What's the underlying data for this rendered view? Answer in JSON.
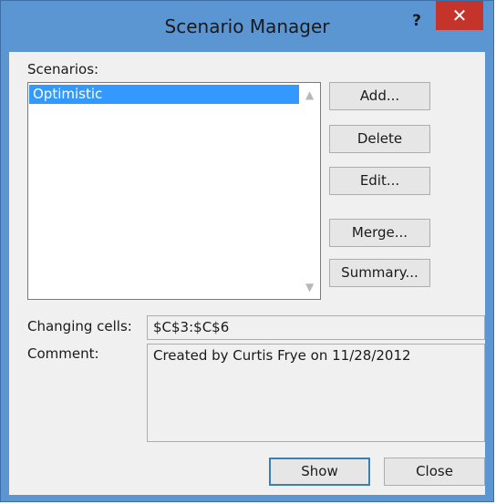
{
  "window": {
    "title": "Scenario Manager",
    "help_glyph": "?",
    "close_glyph": "✕"
  },
  "scenarios": {
    "label": "Scenarios:",
    "items": [
      "Optimistic"
    ]
  },
  "buttons": {
    "add": "Add...",
    "delete": "Delete",
    "edit": "Edit...",
    "merge": "Merge...",
    "summary": "Summary...",
    "show": "Show",
    "close": "Close"
  },
  "changing_cells": {
    "label": "Changing cells:",
    "value": "$C$3:$C$6"
  },
  "comment": {
    "label": "Comment:",
    "value": "Created by Curtis Frye on 11/28/2012"
  },
  "colors": {
    "title_bar": "#5b95d2",
    "close_button": "#c4342b",
    "selection": "#3399ff",
    "dialog_bg": "#f0f0f0"
  }
}
